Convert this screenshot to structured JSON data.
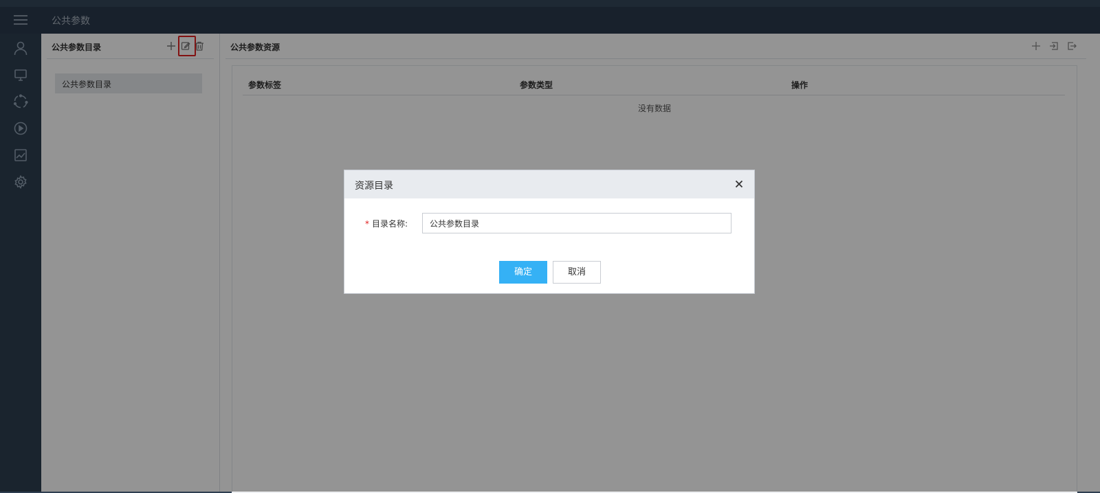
{
  "topbar": {
    "page_title": "公共参数",
    "menu_icon": "hamburger-icon"
  },
  "leftnav": {
    "icons": [
      "user-icon",
      "monitor-icon",
      "cycle-icon",
      "play-icon",
      "chart-icon",
      "settings-icon"
    ]
  },
  "catalog_panel": {
    "title": "公共参数目录",
    "actions": [
      "add-icon",
      "edit-icon",
      "delete-icon"
    ],
    "items": [
      {
        "label": "公共参数目录"
      }
    ]
  },
  "resource_panel": {
    "title": "公共参数资源",
    "actions": [
      "add-icon",
      "import-icon",
      "export-icon"
    ],
    "table": {
      "columns": [
        "参数标签",
        "参数类型",
        "操作"
      ],
      "empty_text": "没有数据"
    }
  },
  "dialog": {
    "title": "资源目录",
    "field_label": "目录名称:",
    "required_mark": "*",
    "field_value": "公共参数目录",
    "ok_label": "确定",
    "cancel_label": "取消"
  },
  "colors": {
    "accent": "#35b1f5",
    "highlight": "#e02020",
    "sidebar": "#2e3e50"
  }
}
